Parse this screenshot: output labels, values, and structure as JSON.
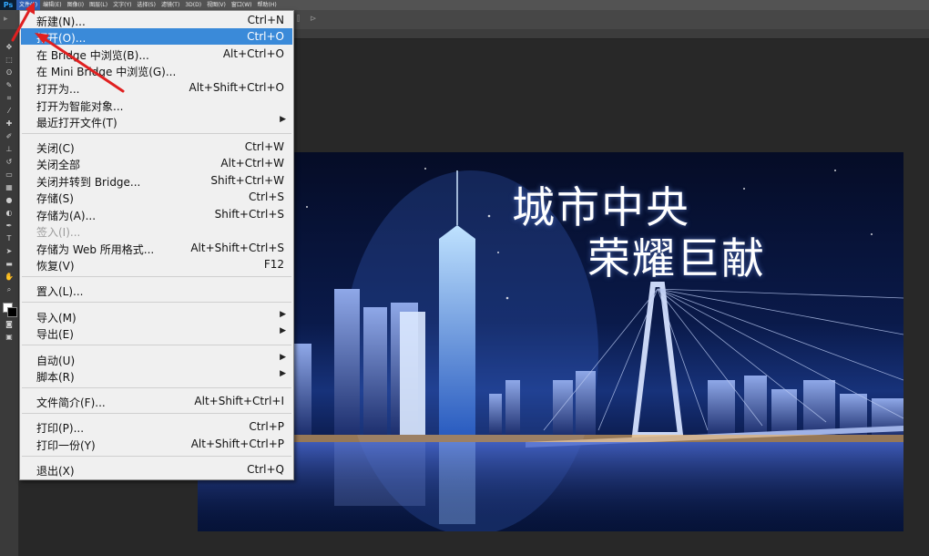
{
  "app": {
    "logo": "Ps"
  },
  "menubar": {
    "items": [
      "文件(F)",
      "编辑(E)",
      "图像(I)",
      "图层(L)",
      "文字(Y)",
      "选择(S)",
      "滤镜(T)",
      "3D(D)",
      "视图(V)",
      "窗口(W)",
      "帮助(H)"
    ],
    "active_index": 0
  },
  "file_menu": {
    "items": [
      {
        "label": "新建(N)...",
        "shortcut": "Ctrl+N"
      },
      {
        "label": "打开(O)...",
        "shortcut": "Ctrl+O"
      },
      {
        "label": "在 Bridge 中浏览(B)...",
        "shortcut": "Alt+Ctrl+O"
      },
      {
        "label": "在 Mini Bridge 中浏览(G)...",
        "shortcut": ""
      },
      {
        "label": "打开为...",
        "shortcut": "Alt+Shift+Ctrl+O"
      },
      {
        "label": "打开为智能对象...",
        "shortcut": ""
      },
      {
        "label": "最近打开文件(T)",
        "shortcut": ""
      },
      {
        "label": "关闭(C)",
        "shortcut": "Ctrl+W"
      },
      {
        "label": "关闭全部",
        "shortcut": "Alt+Ctrl+W"
      },
      {
        "label": "关闭并转到 Bridge...",
        "shortcut": "Shift+Ctrl+W"
      },
      {
        "label": "存储(S)",
        "shortcut": "Ctrl+S"
      },
      {
        "label": "存储为(A)...",
        "shortcut": "Shift+Ctrl+S"
      },
      {
        "label": "签入(I)...",
        "shortcut": ""
      },
      {
        "label": "存储为 Web 所用格式...",
        "shortcut": "Alt+Shift+Ctrl+S"
      },
      {
        "label": "恢复(V)",
        "shortcut": "F12"
      },
      {
        "label": "置入(L)...",
        "shortcut": ""
      },
      {
        "label": "导入(M)",
        "shortcut": ""
      },
      {
        "label": "导出(E)",
        "shortcut": ""
      },
      {
        "label": "自动(U)",
        "shortcut": ""
      },
      {
        "label": "脚本(R)",
        "shortcut": ""
      },
      {
        "label": "文件简介(F)...",
        "shortcut": "Alt+Shift+Ctrl+I"
      },
      {
        "label": "打印(P)...",
        "shortcut": "Ctrl+P"
      },
      {
        "label": "打印一份(Y)",
        "shortcut": "Alt+Shift+Ctrl+P"
      },
      {
        "label": "退出(X)",
        "shortcut": "Ctrl+Q"
      }
    ],
    "highlighted_index": 1,
    "disabled_index": 12
  },
  "canvas": {
    "headline_line1": "城市中央",
    "headline_line2": "荣耀巨献"
  },
  "colors": {
    "menu_highlight": "#3a8ad9",
    "menubar_active": "#2f5fb3",
    "annotation": "#e02020",
    "canvas_sky": "#0a1a4a"
  },
  "icons": {
    "submenu_arrow": "▶"
  }
}
